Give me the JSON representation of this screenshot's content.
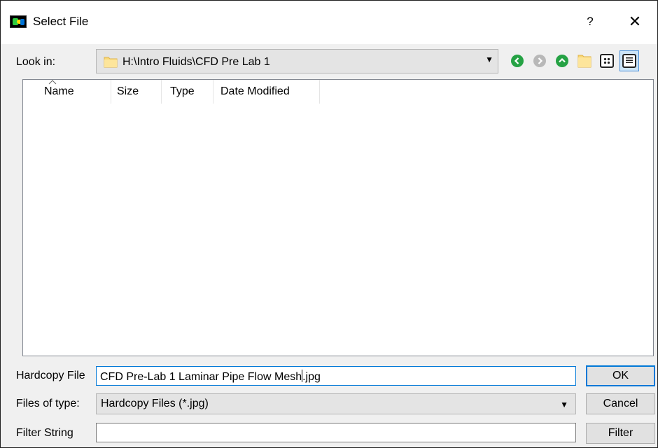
{
  "window": {
    "title": "Select File",
    "help_label": "?",
    "close_label": "✕"
  },
  "lookin": {
    "label": "Look in:",
    "path": "H:\\Intro Fluids\\CFD Pre Lab 1",
    "dropdown_arrow": "▼"
  },
  "toolbar": {
    "icons": [
      "back-icon",
      "forward-icon",
      "parent-folder-icon",
      "new-folder-icon",
      "list-view-icon",
      "detail-view-icon"
    ],
    "accent_green": "#25a244",
    "disabled_grey": "#b8b8b8"
  },
  "filelist": {
    "columns": [
      "Name",
      "Size",
      "Type",
      "Date Modified"
    ],
    "sort_indicator": "^",
    "rows": []
  },
  "hardcopy": {
    "label": "Hardcopy File",
    "value_before_caret": "CFD Pre-Lab 1 Laminar Pipe Flow Mesh",
    "value_after_caret": ".jpg"
  },
  "filetype": {
    "label": "Files of type:",
    "selected": "Hardcopy Files (*.jpg)",
    "dropdown_arrow": "▼"
  },
  "filter": {
    "label": "Filter String",
    "value": ""
  },
  "buttons": {
    "ok": "OK",
    "cancel": "Cancel",
    "filter": "Filter"
  },
  "colors": {
    "focus_blue": "#0078d7",
    "selected_view_bg": "#cce4f7"
  }
}
